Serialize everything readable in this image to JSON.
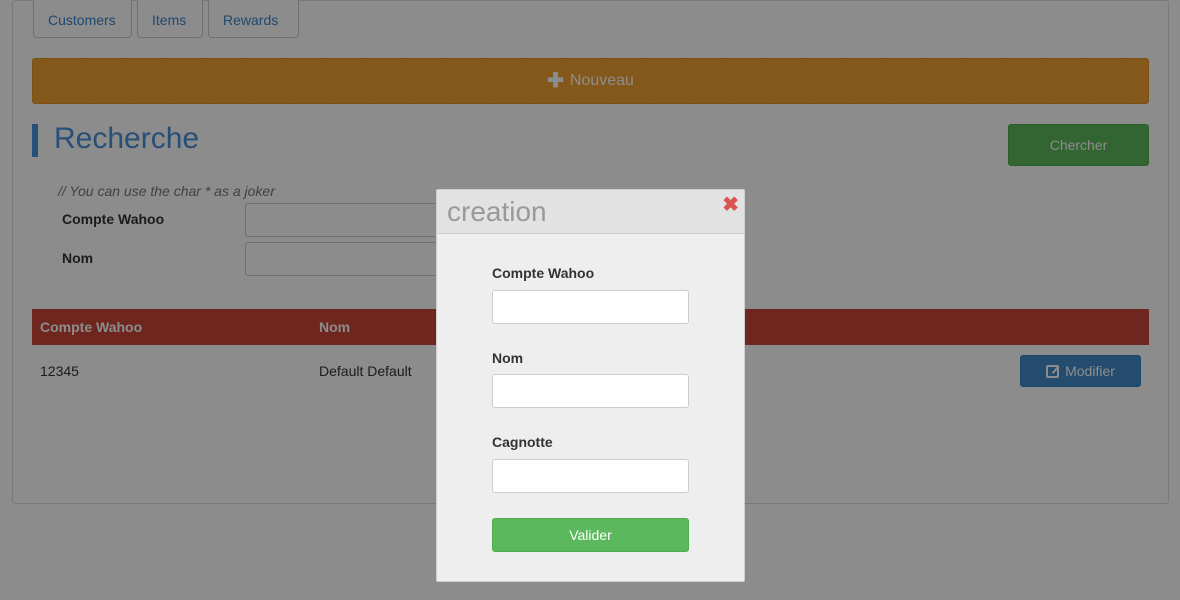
{
  "tabs": [
    "Customers",
    "Items",
    "Rewards"
  ],
  "new_button": {
    "label": "Nouveau",
    "icon": "plus-icon"
  },
  "search": {
    "title": "Recherche",
    "submit_label": "Chercher",
    "hint": "// You can use the char * as a joker",
    "fields": [
      {
        "label": "Compte Wahoo",
        "value": ""
      },
      {
        "label": "Nom",
        "value": ""
      }
    ]
  },
  "table": {
    "headers": [
      "Compte Wahoo",
      "Nom"
    ],
    "rows": [
      {
        "compte": "12345",
        "nom": "Default Default",
        "action": "Modifier"
      }
    ]
  },
  "modal": {
    "title": "creation",
    "close_icon": "close-icon",
    "fields": [
      {
        "label": "Compte Wahoo",
        "value": ""
      },
      {
        "label": "Nom",
        "value": ""
      },
      {
        "label": "Cagnotte",
        "value": ""
      }
    ],
    "submit_label": "Valider"
  },
  "colors": {
    "accent_blue": "#4a90d9",
    "nouveau_orange": "#f0a030",
    "table_header_red": "#c9453a",
    "success_green": "#5cb85c",
    "close_red": "#d9534f"
  }
}
